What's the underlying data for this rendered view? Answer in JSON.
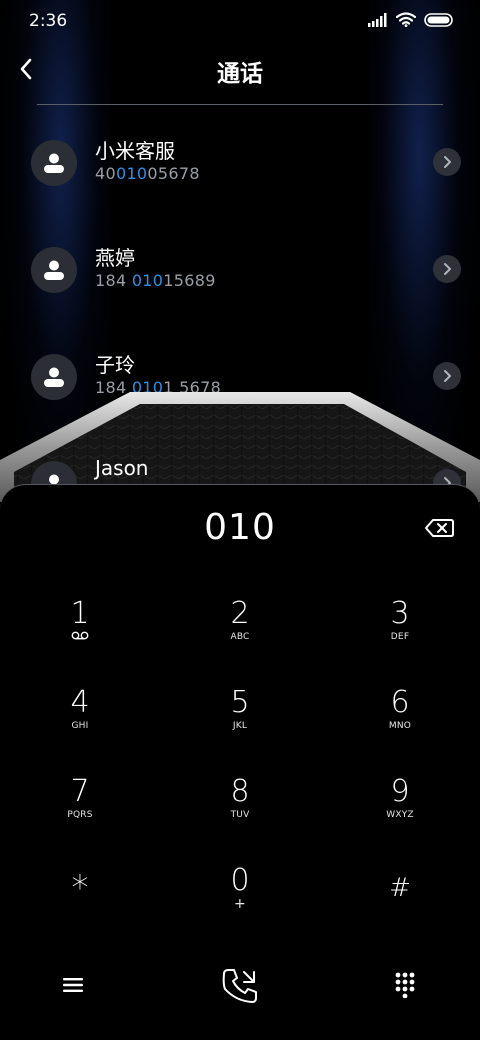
{
  "status_bar": {
    "time": "2:36",
    "icons": [
      "signal-icon",
      "wifi-icon",
      "battery-icon"
    ]
  },
  "header": {
    "back_icon": "back-arrow-icon",
    "title": "通话"
  },
  "contacts": [
    {
      "name": "小米客服",
      "number_parts": [
        "40",
        "010",
        "05678"
      ],
      "icon": "person-icon"
    },
    {
      "name": "燕婷",
      "number_parts": [
        "184 ",
        "010",
        "15689"
      ],
      "icon": "person-icon"
    },
    {
      "name": "子玲",
      "number_parts": [
        "184 ",
        "010",
        "1 5678"
      ],
      "icon": "person-icon"
    },
    {
      "name": "Jason",
      "number_parts": [
        "",
        "",
        ""
      ],
      "icon": "person-icon"
    }
  ],
  "dialpad": {
    "dialed": "010",
    "backspace_icon": "backspace-icon",
    "keys": [
      {
        "num": "1",
        "letters": "",
        "sub_icon": "voicemail-icon"
      },
      {
        "num": "2",
        "letters": "ABC"
      },
      {
        "num": "3",
        "letters": "DEF"
      },
      {
        "num": "4",
        "letters": "GHI"
      },
      {
        "num": "5",
        "letters": "JKL"
      },
      {
        "num": "6",
        "letters": "MNO"
      },
      {
        "num": "7",
        "letters": "PQRS"
      },
      {
        "num": "8",
        "letters": "TUV"
      },
      {
        "num": "9",
        "letters": "WXYZ"
      },
      {
        "num": "*",
        "letters": ""
      },
      {
        "num": "0",
        "letters": "+"
      },
      {
        "num": "#",
        "letters": ""
      }
    ]
  },
  "bottom_bar": {
    "menu_icon": "menu-icon",
    "call_icon": "phone-call-icon",
    "keypad_icon": "keypad-icon"
  },
  "colors": {
    "background": "#000000",
    "highlight": "#2f8fe6",
    "secondary_text": "#9a9ea6",
    "avatar_bg": "#2b2e35"
  }
}
